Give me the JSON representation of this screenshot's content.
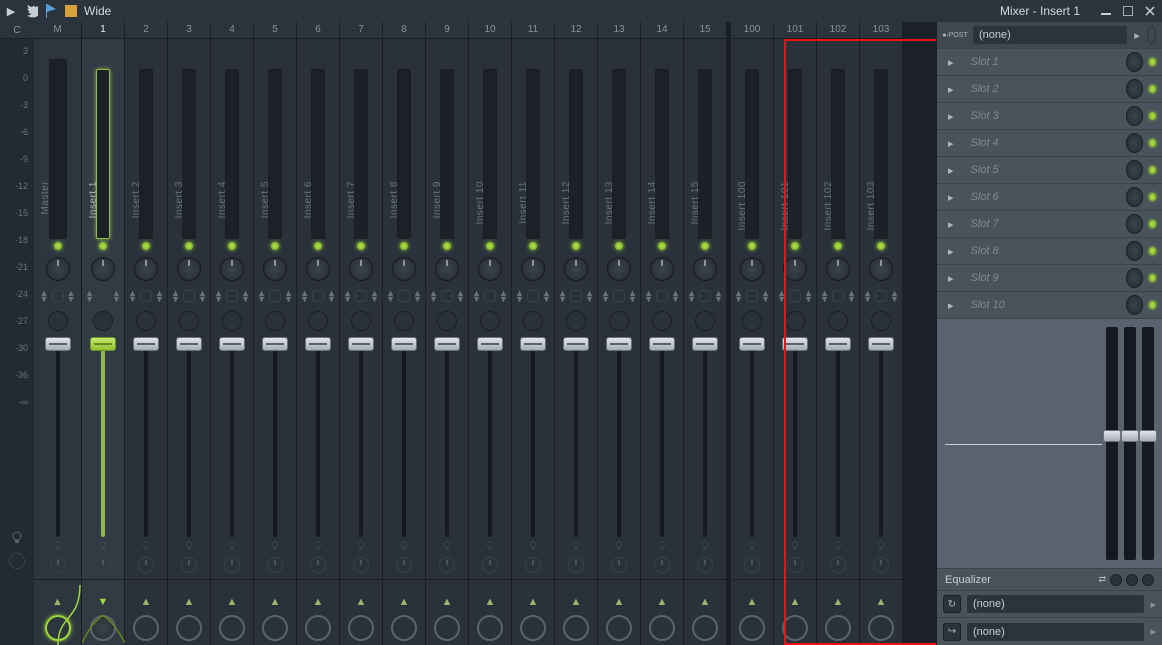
{
  "titlebar": {
    "layout_label": "Wide",
    "window_title": "Mixer - Insert 1"
  },
  "ruler": {
    "header_c": "C",
    "ticks": [
      "3",
      "0",
      "-3",
      "-6",
      "-9",
      "-12",
      "-15",
      "-18",
      "-21",
      "-24",
      "-27",
      "-30",
      "-36",
      "-∞"
    ]
  },
  "tracks": {
    "master": {
      "header": "M",
      "label": "Master"
    },
    "left": [
      {
        "n": "1",
        "label": "Insert 1",
        "selected": true
      },
      {
        "n": "2",
        "label": "Insert 2"
      },
      {
        "n": "3",
        "label": "Insert 3"
      },
      {
        "n": "4",
        "label": "Insert 4"
      },
      {
        "n": "5",
        "label": "Insert 5"
      },
      {
        "n": "6",
        "label": "Insert 6"
      },
      {
        "n": "7",
        "label": "Insert 7"
      },
      {
        "n": "8",
        "label": "Insert 8"
      },
      {
        "n": "9",
        "label": "Insert 9"
      },
      {
        "n": "10",
        "label": "Insert 10"
      },
      {
        "n": "11",
        "label": "Insert 11"
      },
      {
        "n": "12",
        "label": "Insert 12"
      },
      {
        "n": "13",
        "label": "Insert 13"
      },
      {
        "n": "14",
        "label": "Insert 14"
      },
      {
        "n": "15",
        "label": "Insert 15"
      }
    ],
    "right": [
      {
        "n": "100",
        "label": "Insert 100"
      },
      {
        "n": "101",
        "label": "Insert 101"
      },
      {
        "n": "102",
        "label": "Insert 102"
      },
      {
        "n": "103",
        "label": "Insert 103"
      }
    ]
  },
  "fx": {
    "input_channel": "(none)",
    "post_label": "POST",
    "slots": [
      "Slot 1",
      "Slot 2",
      "Slot 3",
      "Slot 4",
      "Slot 5",
      "Slot 6",
      "Slot 7",
      "Slot 8",
      "Slot 9",
      "Slot 10"
    ],
    "eq_label": "Equalizer",
    "out_a": "(none)",
    "out_b": "(none)"
  }
}
